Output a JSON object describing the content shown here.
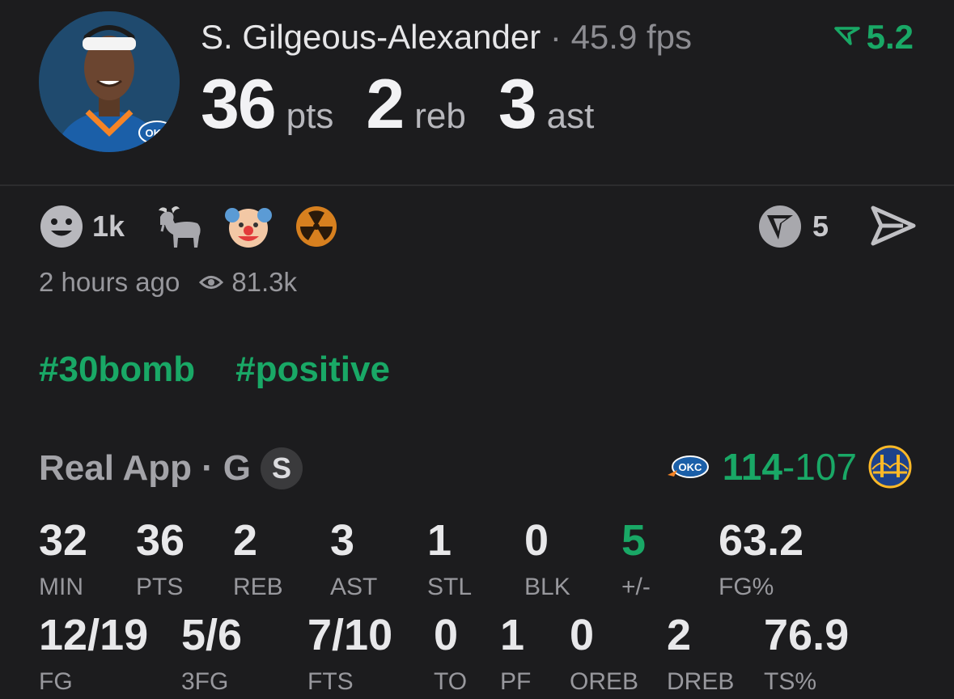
{
  "player": {
    "name": "S. Gilgeous-Alexander",
    "dot": "·",
    "fps": "45.9 fps",
    "rating": "5.2",
    "team_badge": "OKC",
    "summary": [
      {
        "value": "36",
        "unit": "pts"
      },
      {
        "value": "2",
        "unit": "reb"
      },
      {
        "value": "3",
        "unit": "ast"
      }
    ]
  },
  "reactions": {
    "smile_count": "1k",
    "icons": [
      "smile-icon",
      "goat-icon",
      "clown-icon",
      "radioactive-icon"
    ],
    "vote_count": "5"
  },
  "meta": {
    "time": "2 hours ago",
    "views": "81.3k"
  },
  "hashtags": [
    "#30bomb",
    "#positive"
  ],
  "game": {
    "source": "Real App",
    "dot": "·",
    "position": "G",
    "badge": "S",
    "score_home": "114",
    "score_sep": "-",
    "score_away": "107",
    "home_logo": "OKC",
    "away_logo": "golden-gate-bridge-logo"
  },
  "stats_row1": [
    {
      "value": "32",
      "label": "MIN"
    },
    {
      "value": "36",
      "label": "PTS"
    },
    {
      "value": "2",
      "label": "REB"
    },
    {
      "value": "3",
      "label": "AST"
    },
    {
      "value": "1",
      "label": "STL"
    },
    {
      "value": "0",
      "label": "BLK"
    },
    {
      "value": "5",
      "label": "+/-"
    },
    {
      "value": "63.2",
      "label": "FG%"
    }
  ],
  "stats_row2": [
    {
      "value": "12/19",
      "label": "FG"
    },
    {
      "value": "5/6",
      "label": "3FG"
    },
    {
      "value": "7/10",
      "label": "FTS"
    },
    {
      "value": "0",
      "label": "TO"
    },
    {
      "value": "1",
      "label": "PF"
    },
    {
      "value": "0",
      "label": "OREB"
    },
    {
      "value": "2",
      "label": "DREB"
    },
    {
      "value": "76.9",
      "label": "TS%"
    }
  ],
  "colors": {
    "accent": "#19a866",
    "background": "#1c1c1e"
  }
}
